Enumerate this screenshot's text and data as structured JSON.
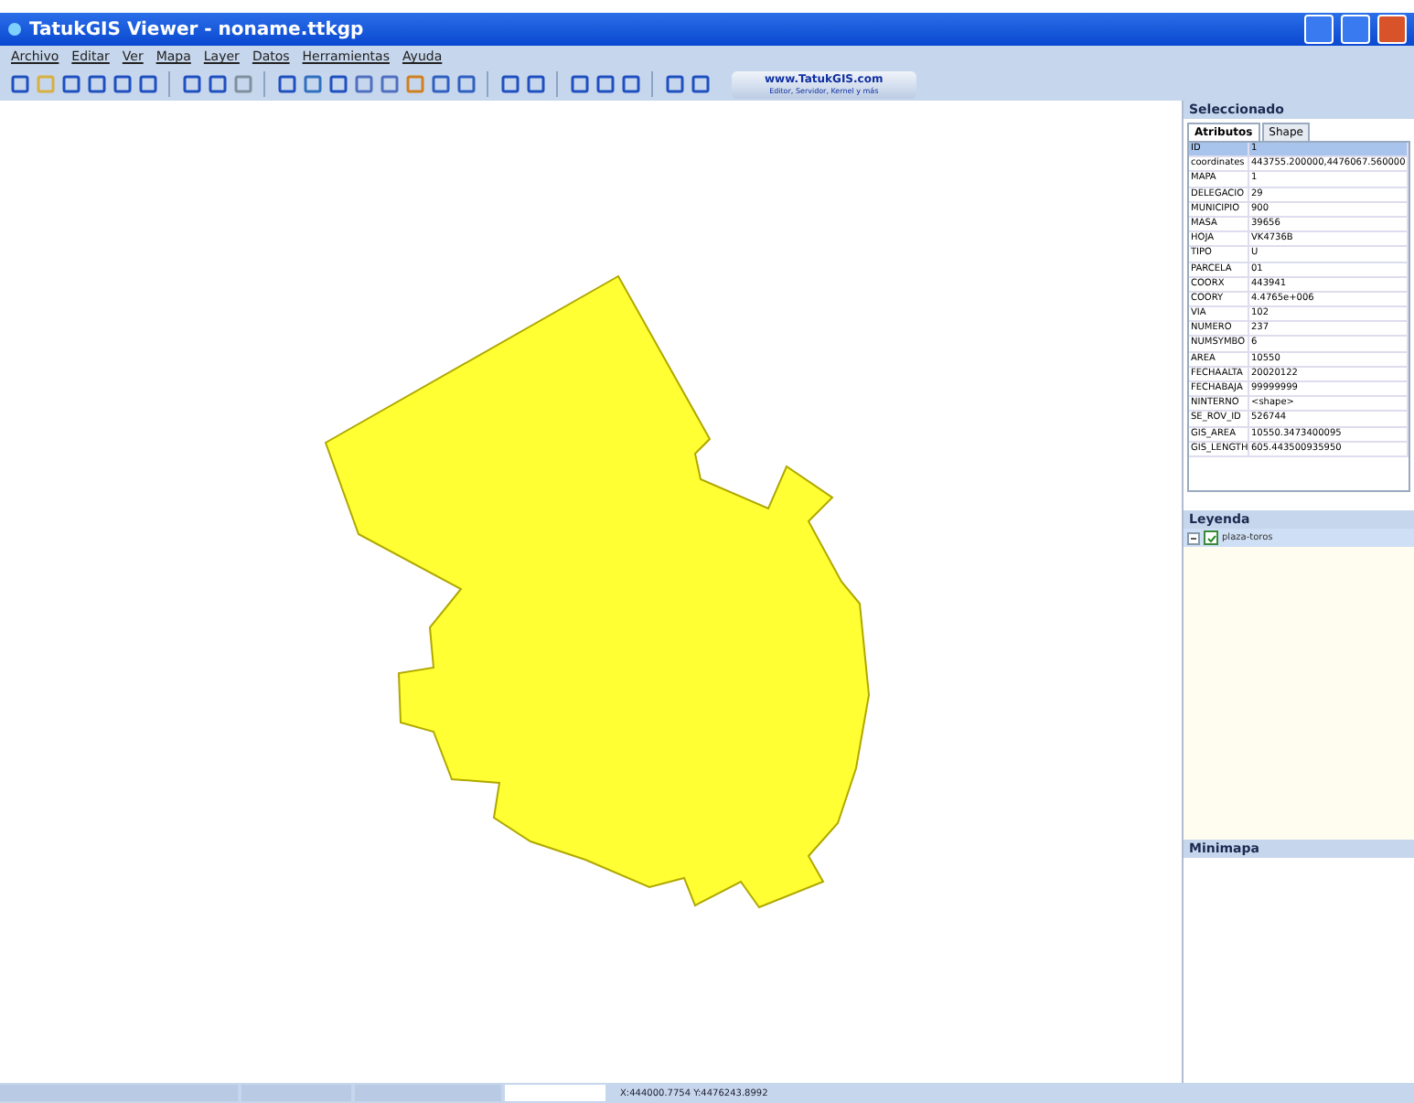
{
  "window": {
    "title": "TatukGIS Viewer - noname.ttkgp"
  },
  "menu": [
    "Archivo",
    "Editar",
    "Ver",
    "Mapa",
    "Layer",
    "Datos",
    "Herramientas",
    "Ayuda"
  ],
  "toolbar": {
    "link_title": "www.TatukGIS.com",
    "link_subtitle": "Editor, Servidor, Kernel y más"
  },
  "selected_panel": {
    "title": "Seleccionado",
    "tabs": [
      {
        "label": "Atributos",
        "selected": true
      },
      {
        "label": "Shape",
        "selected": false
      }
    ],
    "rows": [
      {
        "field": "ID",
        "value": "1",
        "selected": true
      },
      {
        "field": "coordinates",
        "value": "443755.200000,4476067.560000",
        "selected": false
      },
      {
        "field": "MAPA",
        "value": "1",
        "selected": false
      },
      {
        "field": "DELEGACIO",
        "value": "29",
        "selected": false
      },
      {
        "field": "MUNICIPIO",
        "value": "900",
        "selected": false
      },
      {
        "field": "MASA",
        "value": "39656",
        "selected": false
      },
      {
        "field": "HOJA",
        "value": "VK4736B",
        "selected": false
      },
      {
        "field": "TIPO",
        "value": "U",
        "selected": false
      },
      {
        "field": "PARCELA",
        "value": "01",
        "selected": false
      },
      {
        "field": "COORX",
        "value": "443941",
        "selected": false
      },
      {
        "field": "COORY",
        "value": "4.4765e+006",
        "selected": false
      },
      {
        "field": "VIA",
        "value": "102",
        "selected": false
      },
      {
        "field": "NUMERO",
        "value": "237",
        "selected": false
      },
      {
        "field": "NUMSYMBO",
        "value": "6",
        "selected": false
      },
      {
        "field": "AREA",
        "value": "10550",
        "selected": false
      },
      {
        "field": "FECHAALTA",
        "value": "20020122",
        "selected": false
      },
      {
        "field": "FECHABAJA",
        "value": "99999999",
        "selected": false
      },
      {
        "field": "NINTERNO",
        "value": "<shape>",
        "selected": false
      },
      {
        "field": "SE_ROV_ID",
        "value": "526744",
        "selected": false
      },
      {
        "field": "GIS_AREA",
        "value": "10550.3473400095",
        "selected": false
      },
      {
        "field": "GIS_LENGTH",
        "value": "605.443500935950",
        "selected": false
      }
    ]
  },
  "legend_panel": {
    "title": "Leyenda",
    "layers": [
      {
        "name": "plaza-toros",
        "checked": true,
        "expanded": true,
        "selected": true
      }
    ]
  },
  "minimap_panel": {
    "title": "Minimapa"
  },
  "status_bar": {
    "coordinates": "X:444000.7754 Y:4476243.8992"
  }
}
